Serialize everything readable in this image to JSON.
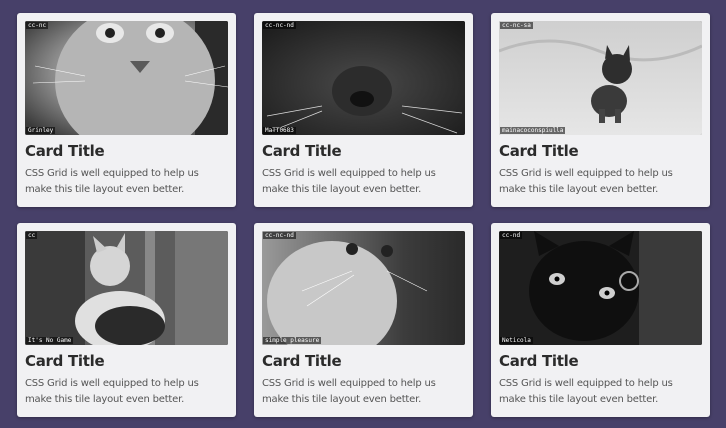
{
  "cards": [
    {
      "license": "cc-nc",
      "credit": "Grinley",
      "title": "Card Title",
      "text": "CSS Grid is well equipped to help us make this tile layout even better."
    },
    {
      "license": "cc-nc-nd",
      "credit": "MaTT0683",
      "title": "Card Title",
      "text": "CSS Grid is well equipped to help us make this tile layout even better."
    },
    {
      "license": "cc-nc-sa",
      "credit": "mainacoconspiulla",
      "title": "Card Title",
      "text": "CSS Grid is well equipped to help us make this tile layout even better."
    },
    {
      "license": "cc",
      "credit": "It's No Game",
      "title": "Card Title",
      "text": "CSS Grid is well equipped to help us make this tile layout even better."
    },
    {
      "license": "cc-nc-nd",
      "credit": "simple pleasure",
      "title": "Card Title",
      "text": "CSS Grid is well equipped to help us make this tile layout even better."
    },
    {
      "license": "cc-nd",
      "credit": "Neticola",
      "title": "Card Title",
      "text": "CSS Grid is well equipped to help us make this tile layout even better."
    }
  ],
  "colors": {
    "background": "#474069",
    "card": "#f1f1f3",
    "title": "#2b2b2b",
    "text": "#555555"
  }
}
